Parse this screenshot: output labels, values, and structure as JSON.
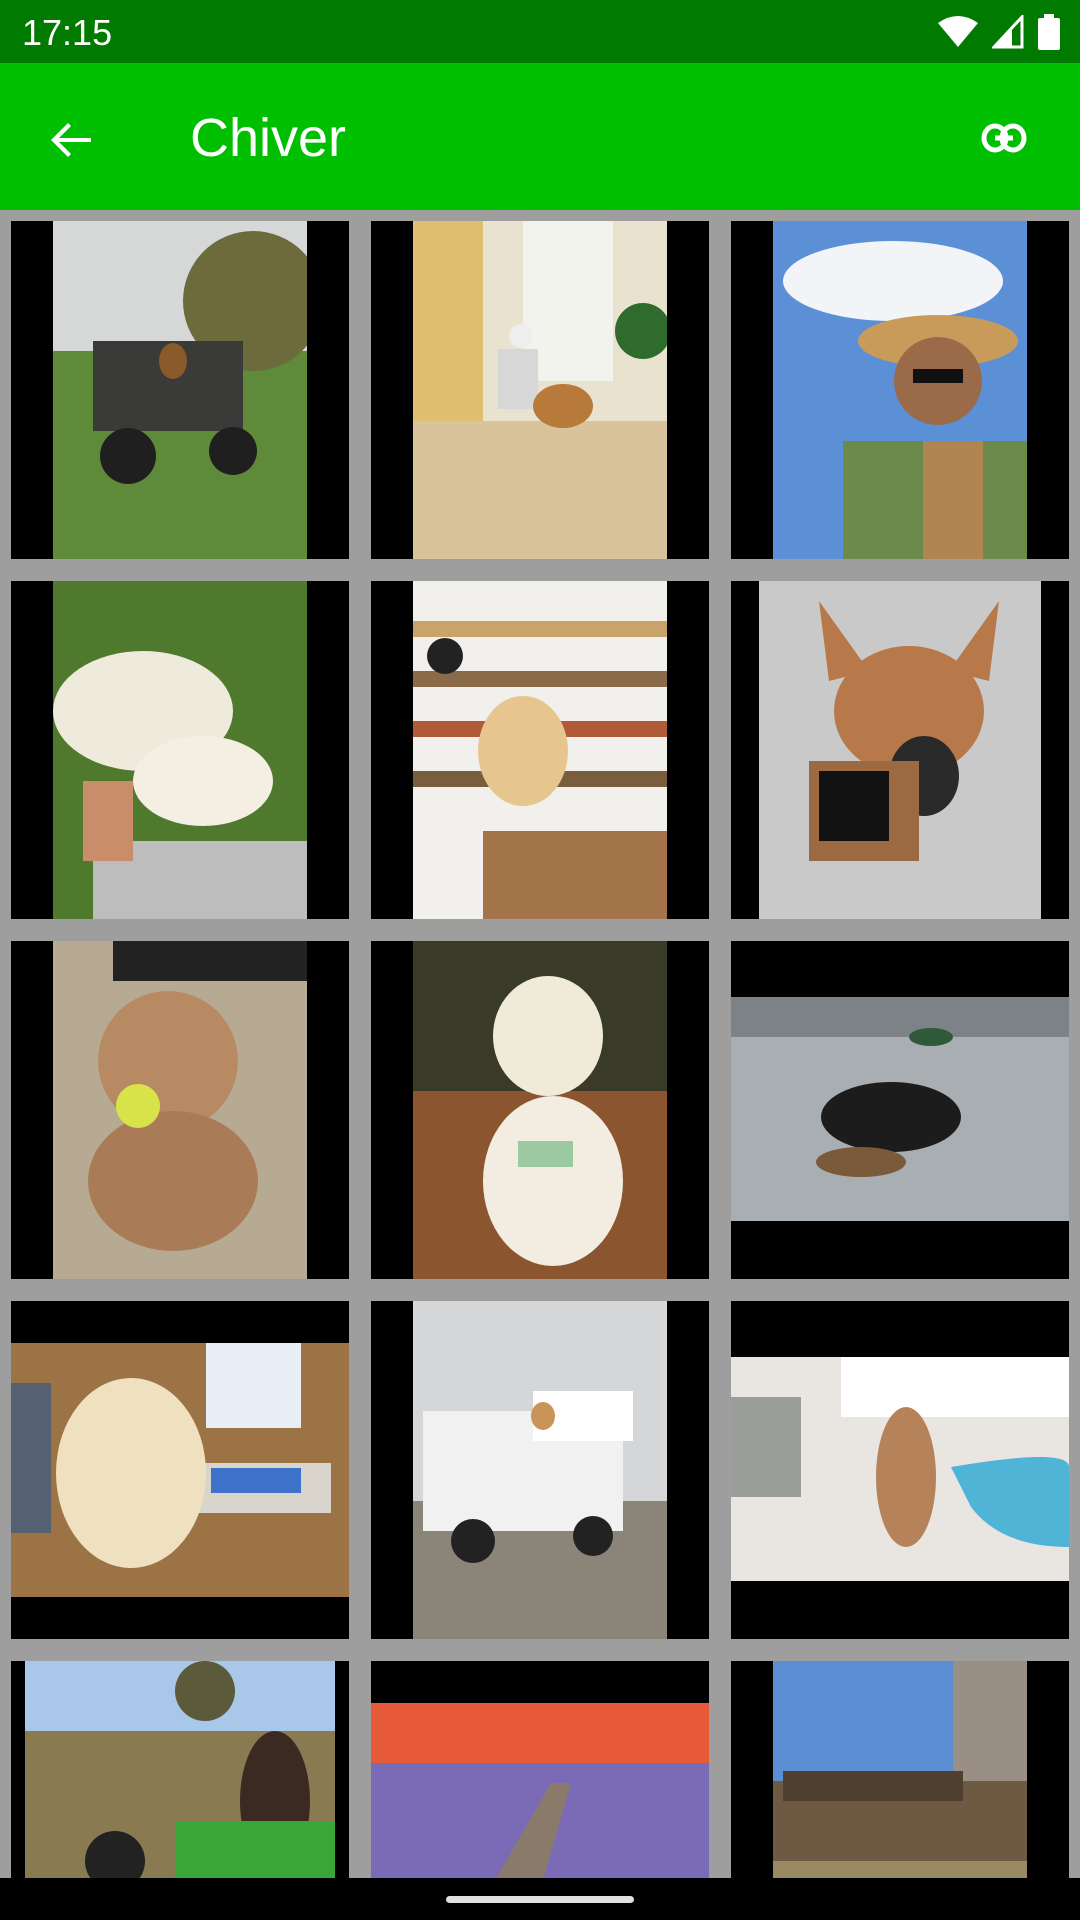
{
  "status_bar": {
    "time": "17:15",
    "icons": [
      "wifi-icon",
      "cell-signal-icon",
      "battery-icon"
    ]
  },
  "app_bar": {
    "title": "Chiver",
    "back_icon": "arrow-back-icon",
    "action_icon": "link-icon",
    "color": "#00bf00",
    "status_color": "#007a00"
  },
  "photos": [
    {
      "name": "photo-dog-on-utility-vehicle"
    },
    {
      "name": "photo-dog-with-elderly-woman"
    },
    {
      "name": "photo-man-in-beekeeper-hat"
    },
    {
      "name": "photo-dog-and-lamb-on-grass"
    },
    {
      "name": "photo-dog-at-bakery-counter"
    },
    {
      "name": "photo-dog-with-muzzle"
    },
    {
      "name": "photo-doodle-with-tennis-ball"
    },
    {
      "name": "photo-dog-with-name-tag"
    },
    {
      "name": "photo-dog-retrieving-duck"
    },
    {
      "name": "photo-dog-at-computer-desk"
    },
    {
      "name": "photo-dog-in-pickup-truck"
    },
    {
      "name": "photo-dog-by-pool"
    },
    {
      "name": "photo-dog-on-toy-tractor"
    },
    {
      "name": "photo-dogs-on-dock-at-sunset"
    },
    {
      "name": "photo-farm-field-with-fence"
    }
  ]
}
